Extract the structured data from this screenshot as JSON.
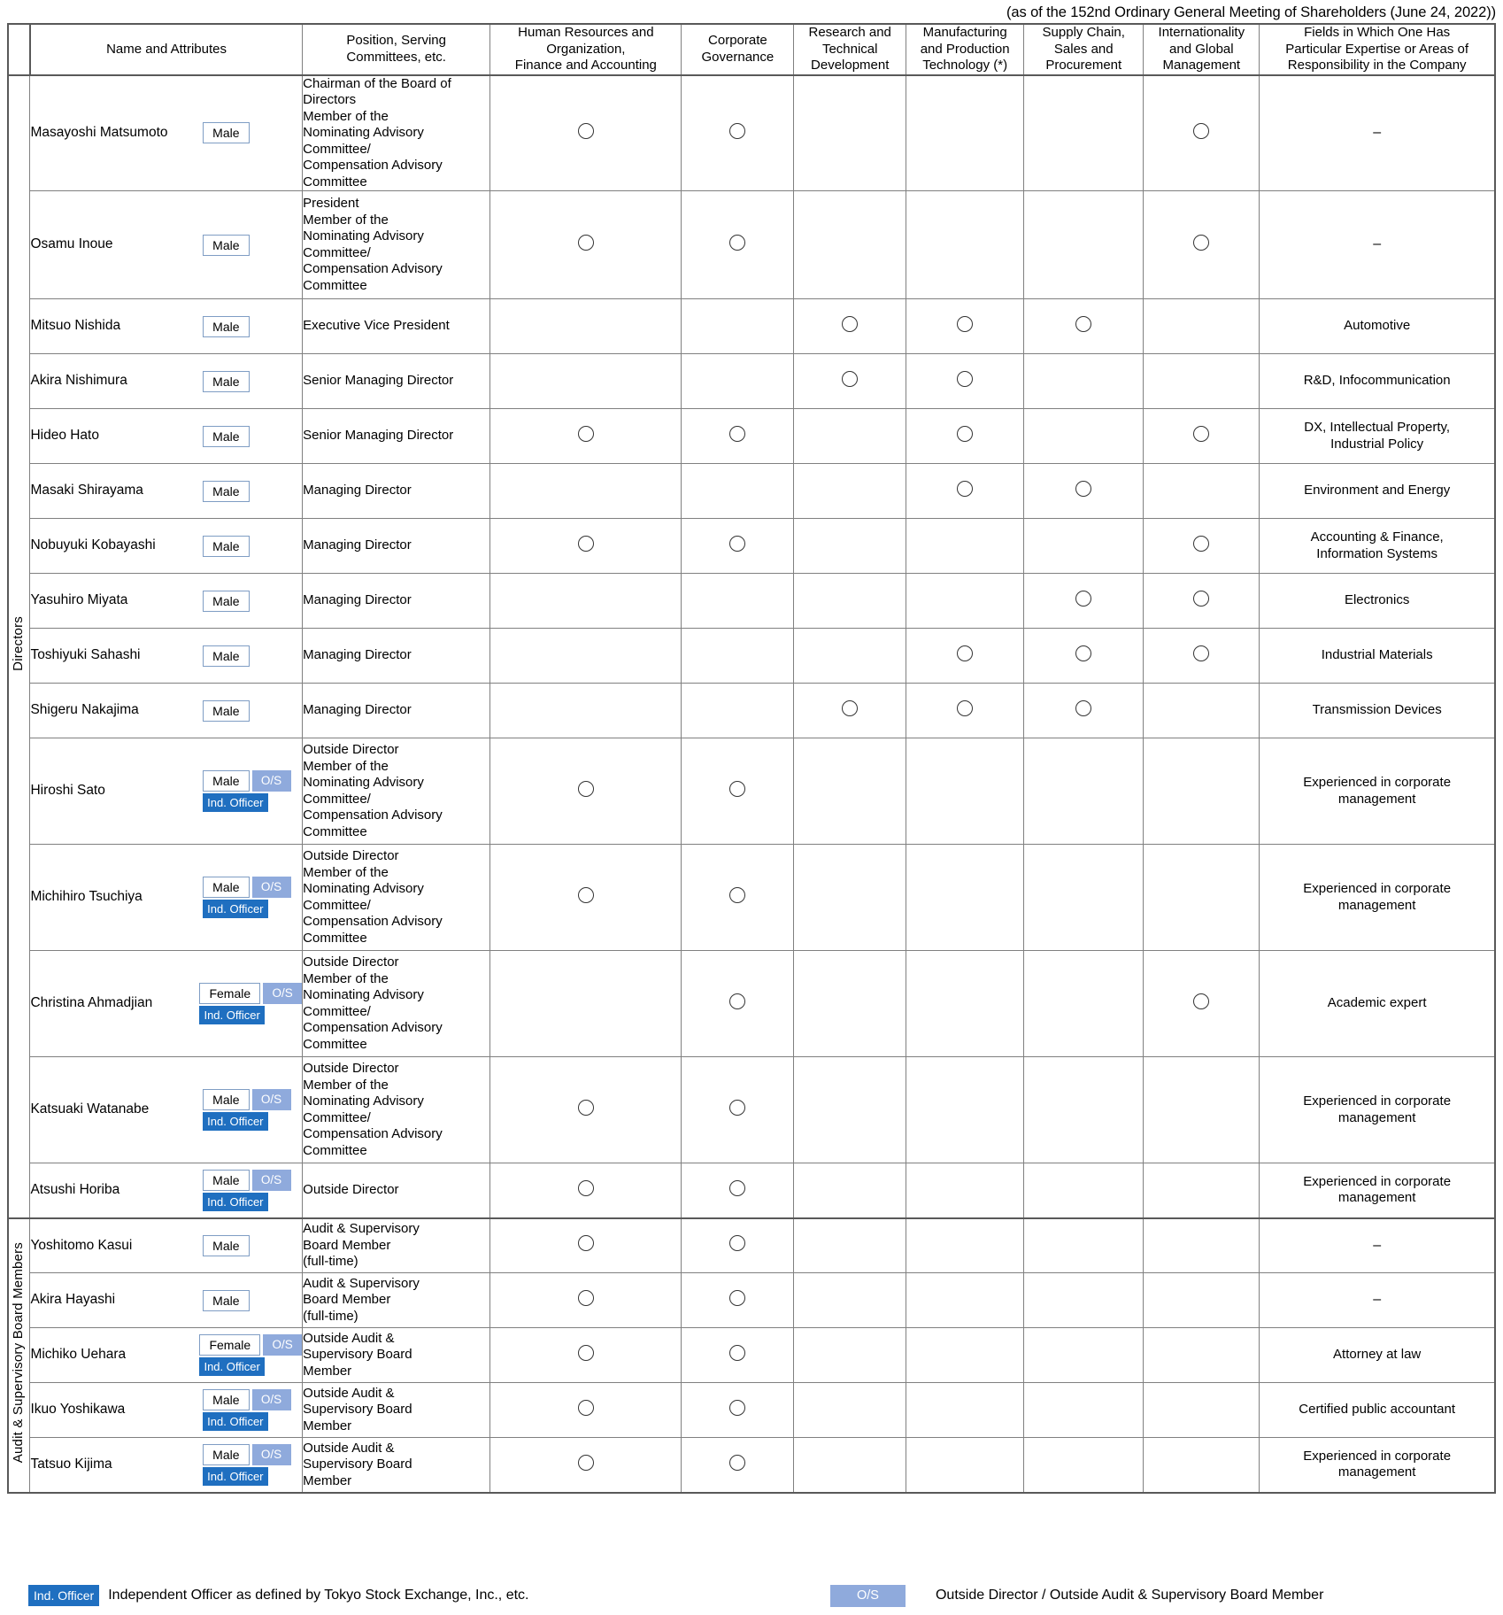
{
  "caption": "(as of the 152nd Ordinary General Meeting of Shareholders (June 24, 2022))",
  "columns": {
    "name": "Name and Attributes",
    "position": "Position, Serving\nCommittees, etc.",
    "position_l1": "Position, Serving",
    "position_l2": "Committees, etc.",
    "hr_l1": "Human Resources and",
    "hr_l2": "Organization,",
    "hr_l3": "Finance and Accounting",
    "cg_l1": "Corporate",
    "cg_l2": "Governance",
    "rd_l1": "Research and",
    "rd_l2": "Technical",
    "rd_l3": "Development",
    "mf_l1": "Manufacturing",
    "mf_l2": "and Production",
    "mf_l3": "Technology (*)",
    "sc_l1": "Supply Chain,",
    "sc_l2": "Sales and",
    "sc_l3": "Procurement",
    "ig_l1": "Internationality",
    "ig_l2": "and Global",
    "ig_l3": "Management",
    "fields_l1": "Fields in Which One Has",
    "fields_l2": "Particular Expertise or Areas of",
    "fields_l3": "Responsibility in the Company"
  },
  "groups": {
    "directors": "Directors",
    "auditors": "Audit & Supervisory Board Members"
  },
  "badge_labels": {
    "male": "Male",
    "female": "Female",
    "outside": "O/S",
    "independent": "Ind. Officer"
  },
  "rows": [
    {
      "name": "Masayoshi Matsumoto",
      "gender": "Male",
      "outside": false,
      "independent": false,
      "position": "Chairman of the Board of\nDirectors\nMember of the\nNominating Advisory\nCommittee/\nCompensation Advisory\nCommittee",
      "hr": true,
      "cg": true,
      "rd": false,
      "mf": false,
      "sc": false,
      "ig": true,
      "fields": "–"
    },
    {
      "name": "Osamu Inoue",
      "gender": "Male",
      "outside": false,
      "independent": false,
      "position": "President\nMember of the\nNominating Advisory\nCommittee/\nCompensation Advisory\nCommittee",
      "hr": true,
      "cg": true,
      "rd": false,
      "mf": false,
      "sc": false,
      "ig": true,
      "fields": "–"
    },
    {
      "name": "Mitsuo Nishida",
      "gender": "Male",
      "outside": false,
      "independent": false,
      "position": "Executive Vice President",
      "hr": false,
      "cg": false,
      "rd": true,
      "mf": true,
      "sc": true,
      "ig": false,
      "fields": "Automotive"
    },
    {
      "name": "Akira Nishimura",
      "gender": "Male",
      "outside": false,
      "independent": false,
      "position": "Senior Managing Director",
      "hr": false,
      "cg": false,
      "rd": true,
      "mf": true,
      "sc": false,
      "ig": false,
      "fields": "R&D, Infocommunication"
    },
    {
      "name": "Hideo Hato",
      "gender": "Male",
      "outside": false,
      "independent": false,
      "position": "Senior Managing Director",
      "hr": true,
      "cg": true,
      "rd": false,
      "mf": true,
      "sc": false,
      "ig": true,
      "fields": "DX, Intellectual Property,\nIndustrial Policy"
    },
    {
      "name": "Masaki Shirayama",
      "gender": "Male",
      "outside": false,
      "independent": false,
      "position": "Managing Director",
      "hr": false,
      "cg": false,
      "rd": false,
      "mf": true,
      "sc": true,
      "ig": false,
      "fields": "Environment and Energy"
    },
    {
      "name": "Nobuyuki Kobayashi",
      "gender": "Male",
      "outside": false,
      "independent": false,
      "position": "Managing Director",
      "hr": true,
      "cg": true,
      "rd": false,
      "mf": false,
      "sc": false,
      "ig": true,
      "fields": "Accounting & Finance,\nInformation Systems"
    },
    {
      "name": "Yasuhiro Miyata",
      "gender": "Male",
      "outside": false,
      "independent": false,
      "position": "Managing Director",
      "hr": false,
      "cg": false,
      "rd": false,
      "mf": false,
      "sc": true,
      "ig": true,
      "fields": "Electronics"
    },
    {
      "name": "Toshiyuki Sahashi",
      "gender": "Male",
      "outside": false,
      "independent": false,
      "position": "Managing Director",
      "hr": false,
      "cg": false,
      "rd": false,
      "mf": true,
      "sc": true,
      "ig": true,
      "fields": "Industrial Materials"
    },
    {
      "name": "Shigeru Nakajima",
      "gender": "Male",
      "outside": false,
      "independent": false,
      "position": "Managing Director",
      "hr": false,
      "cg": false,
      "rd": true,
      "mf": true,
      "sc": true,
      "ig": false,
      "fields": "Transmission Devices"
    },
    {
      "name": "Hiroshi Sato",
      "gender": "Male",
      "outside": true,
      "independent": true,
      "position": "Outside Director\nMember of the\nNominating Advisory\nCommittee/\nCompensation Advisory\nCommittee",
      "hr": true,
      "cg": true,
      "rd": false,
      "mf": false,
      "sc": false,
      "ig": false,
      "fields": "Experienced in corporate\nmanagement"
    },
    {
      "name": "Michihiro Tsuchiya",
      "gender": "Male",
      "outside": true,
      "independent": true,
      "position": "Outside Director\nMember of the\nNominating Advisory\nCommittee/\nCompensation Advisory\nCommittee",
      "hr": true,
      "cg": true,
      "rd": false,
      "mf": false,
      "sc": false,
      "ig": false,
      "fields": "Experienced in corporate\nmanagement"
    },
    {
      "name": "Christina Ahmadjian",
      "gender": "Female",
      "outside": true,
      "independent": true,
      "position": "Outside Director\nMember of the\nNominating Advisory\nCommittee/\nCompensation Advisory\nCommittee",
      "hr": false,
      "cg": true,
      "rd": false,
      "mf": false,
      "sc": false,
      "ig": true,
      "fields": "Academic expert"
    },
    {
      "name": "Katsuaki Watanabe",
      "gender": "Male",
      "outside": true,
      "independent": true,
      "position": "Outside Director\nMember of the\nNominating Advisory\nCommittee/\nCompensation Advisory\nCommittee",
      "hr": true,
      "cg": true,
      "rd": false,
      "mf": false,
      "sc": false,
      "ig": false,
      "fields": "Experienced in corporate\nmanagement"
    },
    {
      "name": "Atsushi Horiba",
      "gender": "Male",
      "outside": true,
      "independent": true,
      "position": "Outside Director",
      "hr": true,
      "cg": true,
      "rd": false,
      "mf": false,
      "sc": false,
      "ig": false,
      "fields": "Experienced in corporate\nmanagement"
    },
    {
      "name": "Yoshitomo Kasui",
      "gender": "Male",
      "outside": false,
      "independent": false,
      "position": "Audit & Supervisory\nBoard Member\n(full-time)",
      "hr": true,
      "cg": true,
      "rd": false,
      "mf": false,
      "sc": false,
      "ig": false,
      "fields": "–"
    },
    {
      "name": "Akira Hayashi",
      "gender": "Male",
      "outside": false,
      "independent": false,
      "position": "Audit & Supervisory\nBoard Member\n(full-time)",
      "hr": true,
      "cg": true,
      "rd": false,
      "mf": false,
      "sc": false,
      "ig": false,
      "fields": "–"
    },
    {
      "name": "Michiko Uehara",
      "gender": "Female",
      "outside": true,
      "independent": true,
      "position": "Outside Audit &\nSupervisory Board\nMember",
      "hr": true,
      "cg": true,
      "rd": false,
      "mf": false,
      "sc": false,
      "ig": false,
      "fields": "Attorney at law"
    },
    {
      "name": "Ikuo Yoshikawa",
      "gender": "Male",
      "outside": true,
      "independent": true,
      "position": "Outside Audit &\nSupervisory Board\nMember",
      "hr": true,
      "cg": true,
      "rd": false,
      "mf": false,
      "sc": false,
      "ig": false,
      "fields": "Certified public accountant"
    },
    {
      "name": "Tatsuo Kijima",
      "gender": "Male",
      "outside": true,
      "independent": true,
      "position": "Outside Audit &\nSupervisory Board\nMember",
      "hr": true,
      "cg": true,
      "rd": false,
      "mf": false,
      "sc": false,
      "ig": false,
      "fields": "Experienced in corporate\nmanagement"
    }
  ],
  "legend": {
    "ind_badge": "Ind. Officer",
    "ind_text": "Independent Officer as defined by Tokyo Stock Exchange, Inc., etc.",
    "os_badge": "O/S",
    "os_text": "Outside Director / Outside Audit & Supervisory Board Member"
  },
  "colors": {
    "ind_badge_bg": "#1f6fc0",
    "os_badge_bg": "#8faadc",
    "grid_line": "#808080",
    "outer_line": "#595959"
  }
}
